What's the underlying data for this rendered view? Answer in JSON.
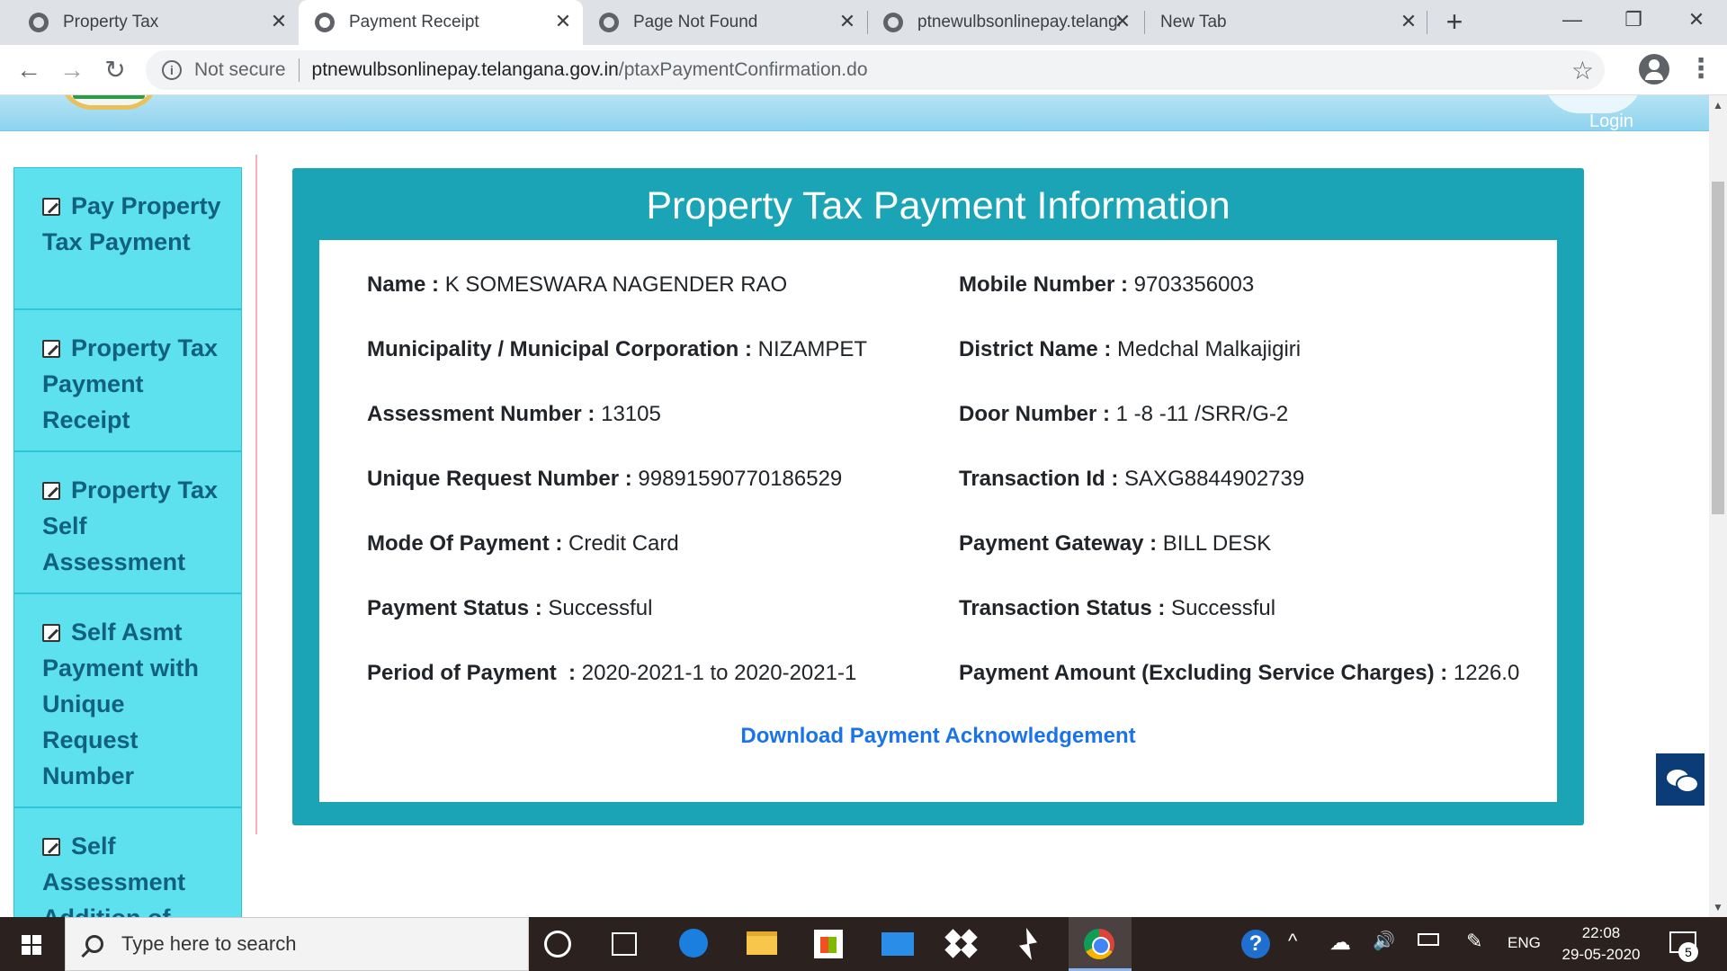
{
  "browser": {
    "tabs": [
      {
        "title": "Property Tax",
        "close": "✕"
      },
      {
        "title": "Payment Receipt",
        "close": "✕"
      },
      {
        "title": "Page Not Found",
        "close": "✕"
      },
      {
        "title": "ptnewulbsonlinepay.telangana.gov.in/",
        "close": "✕"
      },
      {
        "title": "New Tab",
        "close": "✕"
      }
    ],
    "active_tab": 1,
    "new_tab": "+",
    "window_controls": {
      "minimize": "—",
      "restore": "❐",
      "close": "✕"
    },
    "nav": {
      "back": "←",
      "forward": "→",
      "reload": "↻"
    },
    "security_text": "Not secure",
    "url_host": "ptnewulbsonlinepay.telangana.gov.in",
    "url_path": "/ptaxPaymentConfirmation.do",
    "star": "☆",
    "menu": "⋮"
  },
  "site": {
    "login": "Login"
  },
  "sidebar": {
    "items": [
      {
        "label": "Pay Property Tax Payment"
      },
      {
        "label": "Property Tax Payment Receipt"
      },
      {
        "label": "Property Tax Self Assessment"
      },
      {
        "label": "Self Asmt Payment with Unique Request Number"
      },
      {
        "label": "Self Assessment Addition of"
      }
    ]
  },
  "card": {
    "title": "Property Tax Payment Information",
    "fields_left": [
      {
        "label": "Name :",
        "value": " K SOMESWARA NAGENDER RAO"
      },
      {
        "label": "Municipality / Municipal Corporation :",
        "value": " NIZAMPET"
      },
      {
        "label": "Assessment Number :",
        "value": " 13105"
      },
      {
        "label": "Unique Request Number :",
        "value": " 99891590770186529"
      },
      {
        "label": "Mode Of Payment :",
        "value": " Credit Card"
      },
      {
        "label": "Payment Status :",
        "value": " Successful"
      },
      {
        "label": "Period of Payment  :",
        "value": " 2020-2021-1 to 2020-2021-1"
      }
    ],
    "fields_right": [
      {
        "label": "Mobile Number :",
        "value": " 9703356003"
      },
      {
        "label": "District Name :",
        "value": " Medchal Malkajigiri"
      },
      {
        "label": "Door Number :",
        "value": " 1 -8 -11 /SRR/G-2"
      },
      {
        "label": "Transaction Id :",
        "value": " SAXG8844902739"
      },
      {
        "label": "Payment Gateway :",
        "value": " BILL DESK"
      },
      {
        "label": "Transaction Status :",
        "value": " Successful"
      },
      {
        "label": "Payment Amount (Excluding Service Charges) :",
        "value": " 1226.0"
      }
    ],
    "download_link": "Download Payment Acknowledgement"
  },
  "taskbar": {
    "search_placeholder": "Type here to search",
    "help": "?",
    "tray_chevron": "^",
    "volume": "🔊",
    "language": "ENG",
    "time": "22:08",
    "date": "29-05-2020",
    "notifications": "5"
  }
}
